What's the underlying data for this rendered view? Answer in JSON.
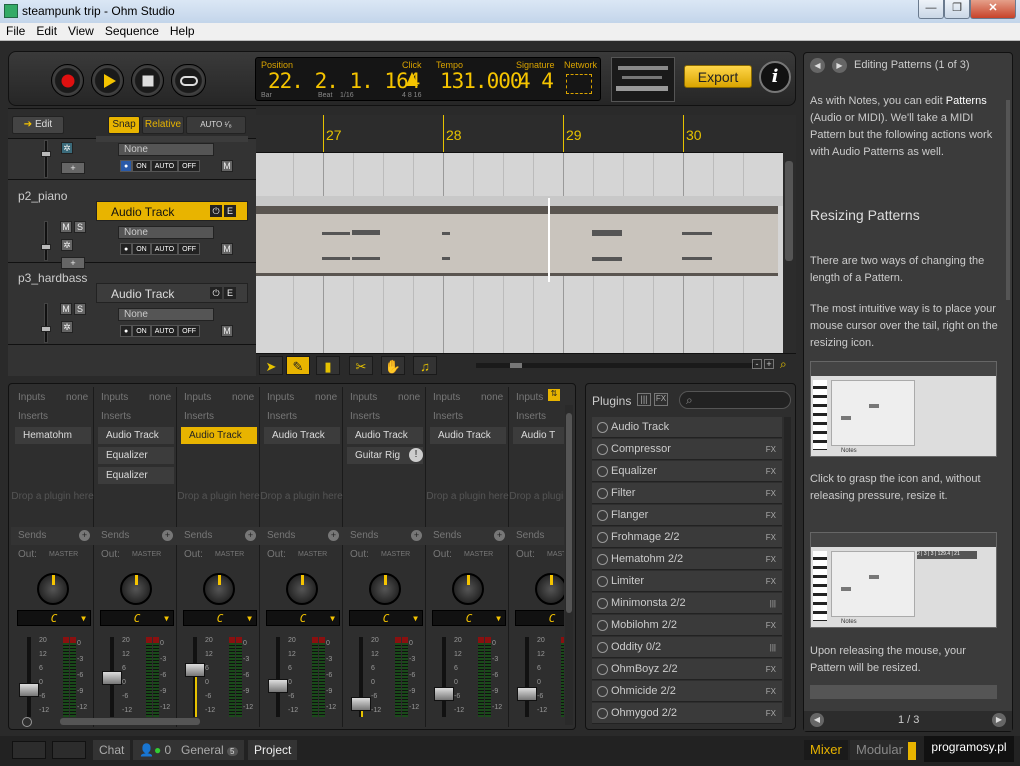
{
  "window": {
    "title": "steampunk trip - Ohm Studio",
    "buttons": [
      "—",
      "❐",
      "✕"
    ]
  },
  "menu": [
    "File",
    "Edit",
    "View",
    "Sequence",
    "Help"
  ],
  "transport": {
    "position_label": "Position",
    "position_value": "22. 2. 1. 164",
    "bar_label": "Bar",
    "beat_label": "Beat",
    "beat_division": "1/16",
    "click_label": "Click",
    "click_opts": "4 8 16",
    "tempo_label": "Tempo",
    "tempo_value": "131.000",
    "signature_label": "Signature",
    "signature_value": "4 4",
    "network_label": "Network",
    "export_label": "Export",
    "info_label": "i"
  },
  "arrange": {
    "edit_label": "Edit",
    "snap_label": "Snap",
    "relative_label": "Relative",
    "auto_label": "AUTO ¹⁄₈",
    "ruler": [
      "27",
      "28",
      "29",
      "30"
    ],
    "tracks": [
      {
        "name": "",
        "type": "",
        "input": "None"
      },
      {
        "name": "p2_piano",
        "type": "Audio Track",
        "input": "None"
      },
      {
        "name": "p3_hardbass",
        "type": "Audio Track",
        "input": "None"
      }
    ],
    "m": "M",
    "s": "S",
    "on": "ON",
    "auto": "AUTO",
    "off": "OFF"
  },
  "mixer": {
    "inputs_label": "Inputs",
    "none": "none",
    "inserts_label": "Inserts",
    "drop_label": "Drop a plugin here",
    "sends_label": "Sends",
    "out_label": "Out:",
    "master": "MASTER",
    "key": "C",
    "strips": [
      {
        "inserts": [
          "Hematohm"
        ]
      },
      {
        "inserts": [
          "Audio Track",
          "Equalizer",
          "Equalizer"
        ]
      },
      {
        "inserts": [
          "Audio Track"
        ]
      },
      {
        "inserts": [
          "Audio Track"
        ]
      },
      {
        "inserts": [
          "Audio Track",
          "Guitar Rig"
        ]
      },
      {
        "inserts": [
          "Audio Track"
        ]
      },
      {
        "inserts": [
          "Audio T"
        ]
      }
    ],
    "scale": [
      "20",
      "12",
      "6",
      "0",
      "-6",
      "-12"
    ],
    "vu_scale": [
      "0",
      "-3",
      "-6",
      "-9",
      "-12"
    ]
  },
  "plugins": {
    "title": "Plugins",
    "items": [
      {
        "name": "Audio Track",
        "fx": ""
      },
      {
        "name": "Compressor",
        "fx": "FX"
      },
      {
        "name": "Equalizer",
        "fx": "FX"
      },
      {
        "name": "Filter",
        "fx": "FX"
      },
      {
        "name": "Flanger",
        "fx": "FX"
      },
      {
        "name": "Frohmage 2/2",
        "fx": "FX"
      },
      {
        "name": "Hematohm 2/2",
        "fx": "FX"
      },
      {
        "name": "Limiter",
        "fx": "FX"
      },
      {
        "name": "Minimonsta 2/2",
        "fx": "|||"
      },
      {
        "name": "Mobilohm 2/2",
        "fx": "FX"
      },
      {
        "name": "Oddity 0/2",
        "fx": "|||"
      },
      {
        "name": "OhmBoyz 2/2",
        "fx": "FX"
      },
      {
        "name": "Ohmicide 2/2",
        "fx": "FX"
      },
      {
        "name": "Ohmygod 2/2",
        "fx": "FX"
      }
    ]
  },
  "help": {
    "header": "Editing Patterns (1 of 3)",
    "p1a": "As with Notes, you can edit",
    "p1b": "Patterns",
    "p1c": "(Audio or MIDI). We'll take a MIDI Pattern but the following actions work with Audio Patterns as well.",
    "heading": "Resizing Patterns",
    "p2": "There are two ways of changing the length of a Pattern.",
    "p3": "The most intuitive way is to place your mouse cursor over the tail, right on the resizing icon.",
    "p4": "Click to grasp the icon and, without releasing pressure, resize it.",
    "p5": "Upon releasing the mouse, your Pattern will be resized.",
    "page": "1 / 3",
    "thumb_label": "Notes",
    "thumb_info": "2 | 3 | 3 | 129.4 | 21"
  },
  "status": {
    "chat": "Chat",
    "users": "0",
    "general": "General",
    "general_count": "5",
    "project": "Project",
    "mixer": "Mixer",
    "modular": "Modular",
    "watermark": "programosy.pl"
  }
}
